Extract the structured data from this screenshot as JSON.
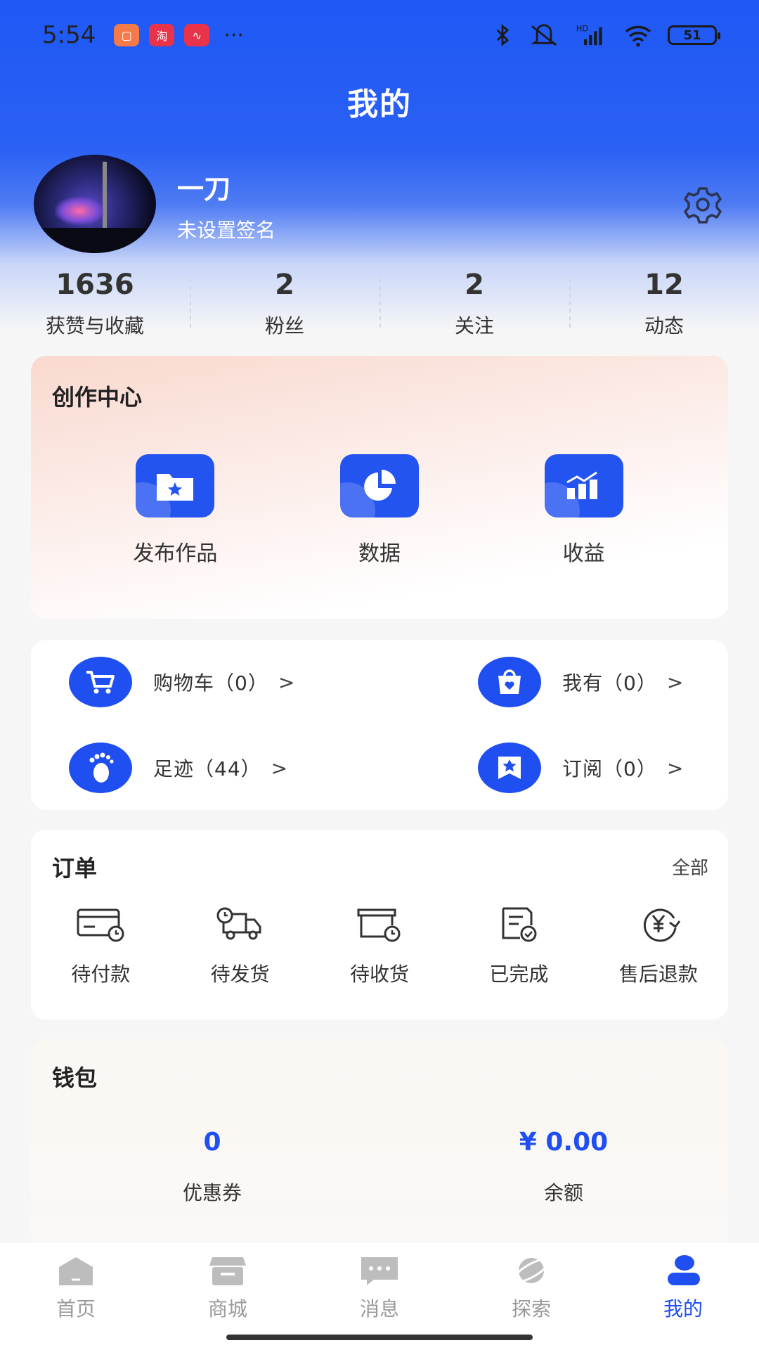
{
  "status_bar": {
    "time": "5:54",
    "more": "···",
    "battery": "51",
    "network": "HD"
  },
  "header": {
    "title": "我的"
  },
  "profile": {
    "name": "一刀",
    "signature": "未设置签名"
  },
  "stats": [
    {
      "value": "1636",
      "label": "获赞与收藏"
    },
    {
      "value": "2",
      "label": "粉丝"
    },
    {
      "value": "2",
      "label": "关注"
    },
    {
      "value": "12",
      "label": "动态"
    }
  ],
  "creation_center": {
    "title": "创作中心",
    "items": [
      {
        "label": "发布作品",
        "icon": "folder-star-icon"
      },
      {
        "label": "数据",
        "icon": "pie-chart-icon"
      },
      {
        "label": "收益",
        "icon": "bar-chart-icon"
      }
    ]
  },
  "shortcuts": [
    {
      "label": "购物车（0）",
      "icon": "cart-icon"
    },
    {
      "label": "我有（0）",
      "icon": "bag-heart-icon"
    },
    {
      "label": "足迹（44）",
      "icon": "footprint-icon"
    },
    {
      "label": "订阅（0）",
      "icon": "bookmark-star-icon"
    }
  ],
  "shortcut_arrow": ">",
  "orders": {
    "title": "订单",
    "all_label": "全部",
    "items": [
      {
        "label": "待付款",
        "icon": "card-clock-icon"
      },
      {
        "label": "待发货",
        "icon": "truck-clock-icon"
      },
      {
        "label": "待收货",
        "icon": "box-clock-icon"
      },
      {
        "label": "已完成",
        "icon": "doc-check-icon"
      },
      {
        "label": "售后退款",
        "icon": "yuan-refund-icon"
      }
    ]
  },
  "wallet": {
    "title": "钱包",
    "items": [
      {
        "value": "0",
        "label": "优惠券"
      },
      {
        "value": "¥ 0.00",
        "label": "余额"
      }
    ]
  },
  "tabbar": {
    "items": [
      {
        "label": "首页",
        "icon": "home-icon"
      },
      {
        "label": "商城",
        "icon": "store-icon"
      },
      {
        "label": "消息",
        "icon": "message-icon"
      },
      {
        "label": "探索",
        "icon": "planet-icon"
      },
      {
        "label": "我的",
        "icon": "profile-icon"
      }
    ],
    "active_index": 4
  },
  "colors": {
    "accent": "#1f4ff0",
    "header_bg": "#1f58f5",
    "page_bg": "#f6f6f7",
    "tab_inactive": "#9a9a9a"
  }
}
